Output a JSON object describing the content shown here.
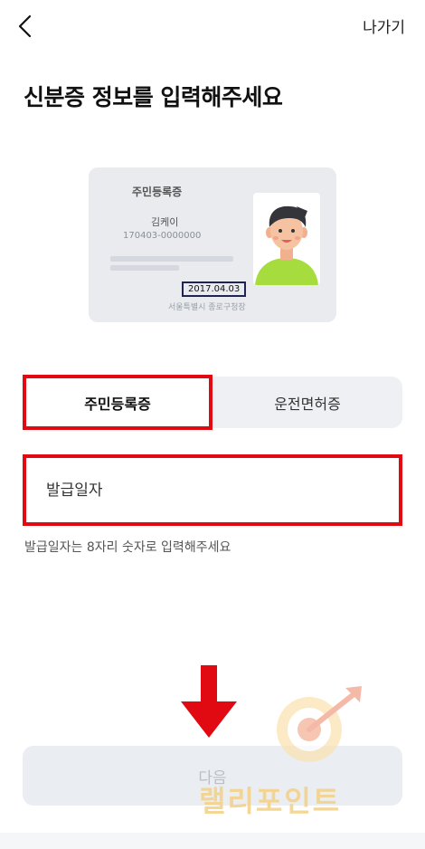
{
  "header": {
    "back_icon": "chevron-left-icon",
    "exit_label": "나가기"
  },
  "page": {
    "title": "신분증 정보를 입력해주세요"
  },
  "card_illustration": {
    "card_type": "주민등록증",
    "name": "김케이",
    "id_number": "170403-0000000",
    "issue_date": "2017.04.03",
    "issuer": "서울특별시 종로구청장"
  },
  "tabs": [
    {
      "label": "주민등록증",
      "selected": true
    },
    {
      "label": "운전면허증",
      "selected": false
    }
  ],
  "form": {
    "issue_date_placeholder": "발급일자",
    "issue_date_value": "",
    "helper_text": "발급일자는 8자리 숫자로 입력해주세요"
  },
  "footer": {
    "next_label": "다음"
  },
  "watermark": {
    "text": "랠리포인트",
    "icon": "target-icon"
  },
  "colors": {
    "highlight_red": "#e20a12",
    "tab_bg": "#eef0f4",
    "button_disabled_bg": "#eaedf2",
    "button_disabled_text": "#b9bec7"
  }
}
